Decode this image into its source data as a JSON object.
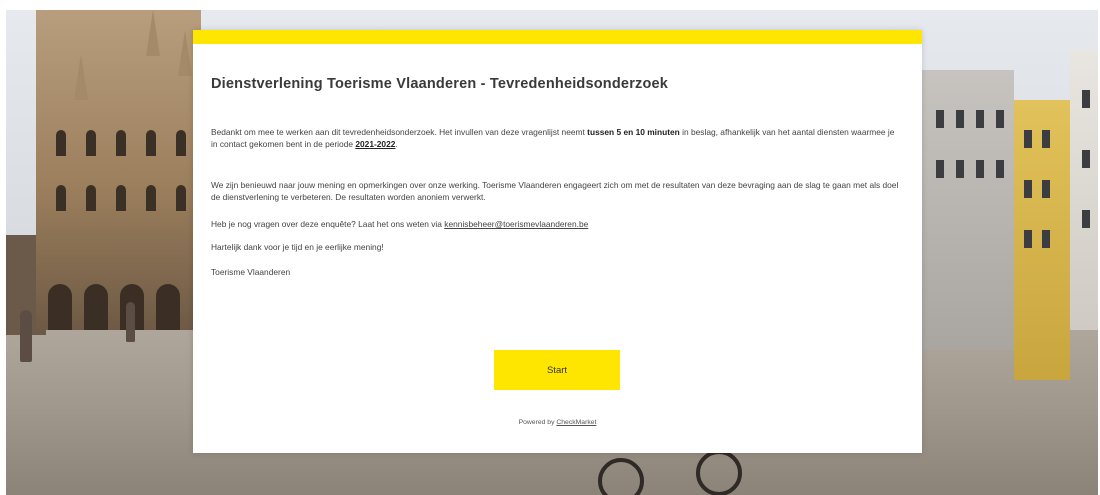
{
  "card": {
    "title": "Dienstverlening Toerisme Vlaanderen - Tevredenheidsonderzoek",
    "intro": {
      "part1": "Bedankt om mee te werken aan dit tevredenheidsonderzoek. Het invullen van deze vragenlijst neemt ",
      "bold_duration": "tussen 5 en 10 minuten",
      "part2": " in beslag, afhankelijk van het aantal diensten waarmee je in contact gekomen bent in de periode ",
      "period": "2021-2022",
      "part3": "."
    },
    "opinion_text": "We zijn benieuwd naar jouw mening en opmerkingen over onze werking. Toerisme Vlaanderen engageert zich om met de resultaten van deze bevraging aan de slag te gaan met als doel de dienstverlening te verbeteren.  De resultaten worden anoniem verwerkt.",
    "questions_text": "Heb je nog vragen over deze enquête? Laat het ons weten via ",
    "questions_email": "kennisbeheer@toerismevlaanderen.be",
    "thanks_text": "Hartelijk dank voor je tijd en je eerlijke mening!",
    "signature": "Toerisme Vlaanderen",
    "start_label": "Start",
    "powered_prefix": "Powered by ",
    "powered_link": "CheckMarket"
  },
  "colors": {
    "accent_yellow": "#ffe600",
    "card_background": "#ffffff",
    "text": "#444444"
  }
}
